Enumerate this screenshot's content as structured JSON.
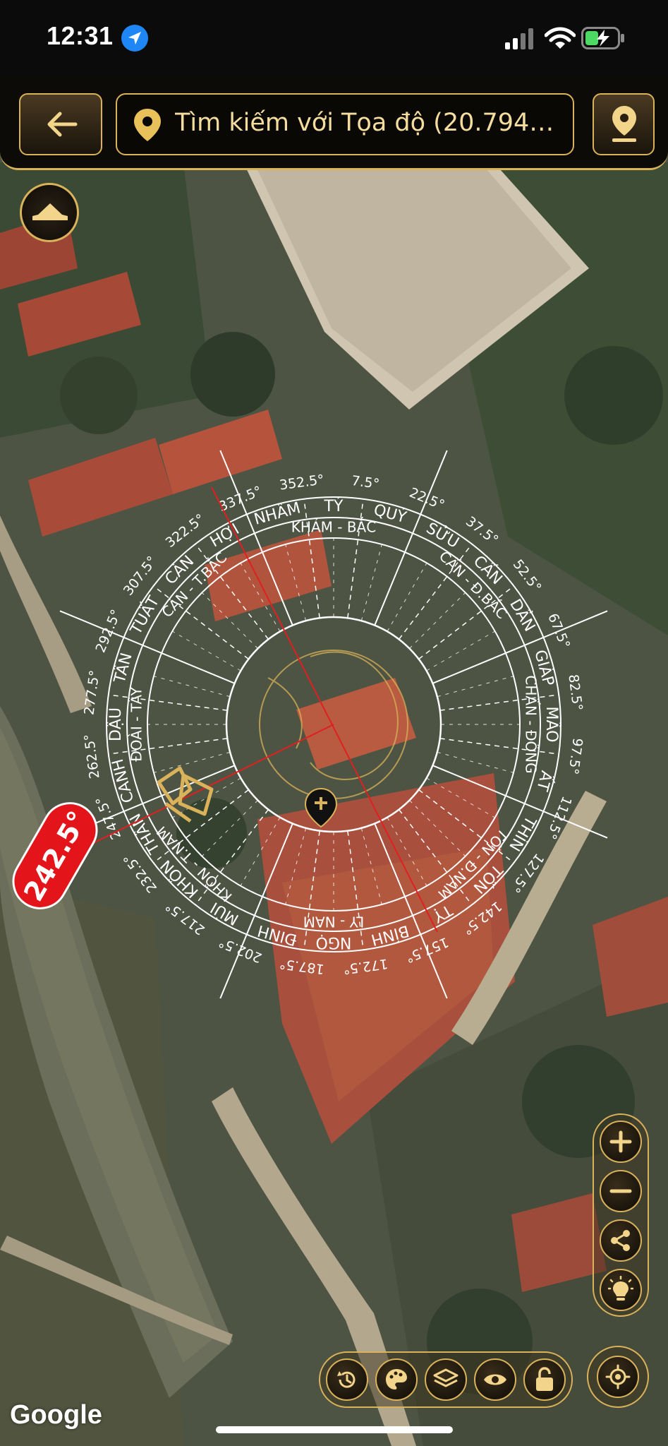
{
  "status_bar": {
    "time": "12:31",
    "location_icon": "location-arrow-icon",
    "signal_icon": "cellular-signal-icon",
    "wifi_icon": "wifi-icon",
    "battery_icon": "battery-charging-icon"
  },
  "header": {
    "back_icon": "arrow-left-icon",
    "search_text": "Tìm kiếm với Tọa độ (20.7949...",
    "search_icon": "map-pin-icon",
    "locate_icon": "map-pin-icon"
  },
  "map": {
    "attribution": "Google",
    "heading_badge": "242.5°",
    "collapse_icon": "hat-icon"
  },
  "compass": {
    "degree_labels": [
      "7.5°",
      "22.5°",
      "37.5°",
      "52.5°",
      "67.5°",
      "82.5°",
      "97.5°",
      "112.5°",
      "127.5°",
      "142.5°",
      "157.5°",
      "172.5°",
      "187.5°",
      "202.5°",
      "217.5°",
      "232.5°",
      "247.5°",
      "262.5°",
      "277.5°",
      "292.5°",
      "307.5°",
      "322.5°",
      "337.5°",
      "352.5°"
    ],
    "mountains": [
      "TÝ",
      "QUÝ",
      "SỬU",
      "CẤN",
      "DẦN",
      "GIÁP",
      "MÃO",
      "ẤT",
      "THÌN",
      "TỐN",
      "TỴ",
      "BÍNH",
      "NGỌ",
      "ĐINH",
      "MÙI",
      "KHÔN",
      "THÂN",
      "CANH",
      "DẬU",
      "TÂN",
      "TUẤT",
      "CÀN",
      "HỢI",
      "NHÂM"
    ],
    "trigrams": [
      "KHẢM - BẮC",
      "CẤN - Đ.BẮC",
      "CHẤN - ĐÔNG",
      "TỐN - Đ.NAM",
      "LY - NAM",
      "KHÔN - T.NAM",
      "ĐOÀI - TÂY",
      "CÀN - T.BẮC"
    ],
    "colors": {
      "ring": "#ffffff",
      "heading_line": "#e02020",
      "accent": "#d9b25a",
      "badge": "#e4141b"
    }
  },
  "zoom_controls": {
    "zoom_in_icon": "plus-icon",
    "zoom_out_icon": "minus-icon",
    "share_icon": "share-icon",
    "brightness_icon": "lightbulb-icon"
  },
  "bottom_toolbar": {
    "history_icon": "history-icon",
    "palette_icon": "palette-icon",
    "layers_icon": "layers-icon",
    "eye_icon": "eye-icon",
    "lock_icon": "lock-icon",
    "target_icon": "target-icon"
  }
}
